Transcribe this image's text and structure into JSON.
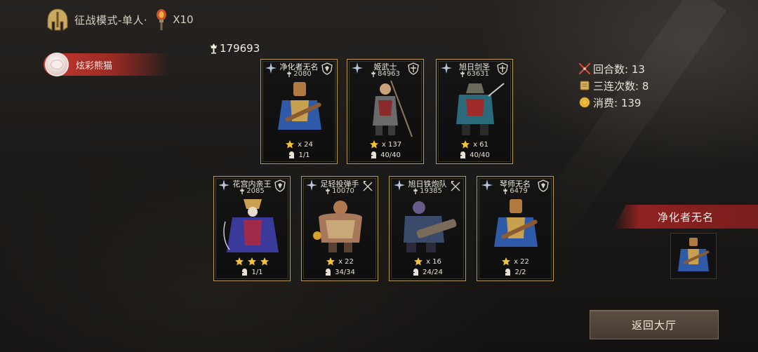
{
  "header": {
    "mode_label": "征战模式-单人·",
    "ticket_count": "X10"
  },
  "player": {
    "name": "炫彩熊猫"
  },
  "total_power": "179693",
  "stats": {
    "rounds": "回合数: 13",
    "triples": "三连次数: 8",
    "cost": "消费: 139"
  },
  "heroes": [
    {
      "name": "净化者无名",
      "power": "2080",
      "stars": "x 24",
      "troops": "1/1",
      "class_icon": "shield-crest-icon",
      "accent": "#2f5aa8"
    },
    {
      "name": "姬武士",
      "power": "84963",
      "stars": "x 137",
      "troops": "40/40",
      "class_icon": "shield-icon",
      "accent": "#8a2b2b"
    },
    {
      "name": "旭日剑圣",
      "power": "63631",
      "stars": "x 61",
      "troops": "40/40",
      "class_icon": "shield-icon",
      "accent": "#2a6a7a"
    },
    {
      "name": "花宫内亲王",
      "power": "2085",
      "stars": "",
      "troops": "1/1",
      "class_icon": "shield-crest-icon",
      "accent": "#3a3a9a"
    },
    {
      "name": "足轻投弹手",
      "power": "10070",
      "stars": "x 22",
      "troops": "34/34",
      "class_icon": "crossbow-icon",
      "accent": "#8a6a3a"
    },
    {
      "name": "旭日铁炮队",
      "power": "19385",
      "stars": "x 16",
      "troops": "24/24",
      "class_icon": "crossbow-icon",
      "accent": "#3a4a6a"
    },
    {
      "name": "琴师无名",
      "power": "6479",
      "stars": "x 22",
      "troops": "2/2",
      "class_icon": "shield-crest-icon",
      "accent": "#2f5aa8"
    }
  ],
  "selected": {
    "name": "净化者无名"
  },
  "return_button": "返回大厅",
  "colors": {
    "gold_border": "#b89a55",
    "banner_red": "#c23a30",
    "star_gold": "#f2c23a"
  }
}
